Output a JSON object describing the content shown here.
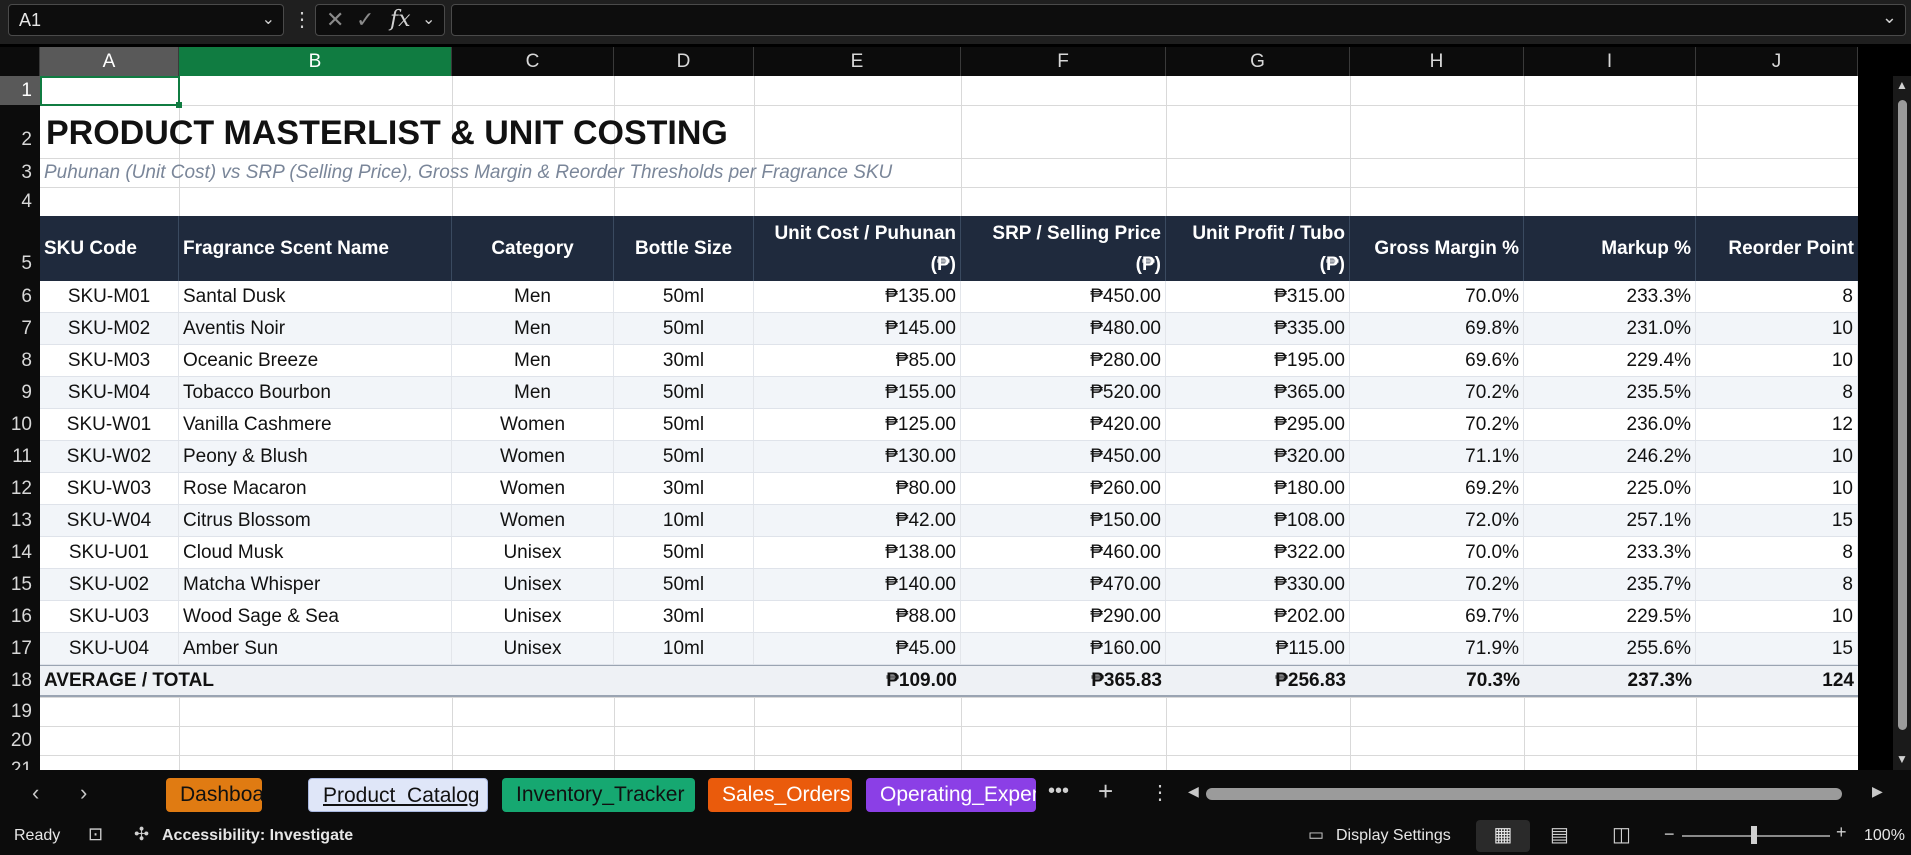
{
  "name_box": "A1",
  "formula": "",
  "columns": [
    "A",
    "B",
    "C",
    "D",
    "E",
    "F",
    "G",
    "H",
    "I",
    "J"
  ],
  "rows": [
    "1",
    "2",
    "3",
    "4",
    "5",
    "6",
    "7",
    "8",
    "9",
    "10",
    "11",
    "12",
    "13",
    "14",
    "15",
    "16",
    "17",
    "18",
    "19",
    "20",
    "21"
  ],
  "title": "PRODUCT MASTERLIST & UNIT COSTING",
  "subtitle": "Puhunan (Unit Cost) vs SRP (Selling Price), Gross Margin & Reorder Thresholds per Fragrance SKU",
  "headers": {
    "sku": "SKU Code",
    "name": "Fragrance Scent Name",
    "category": "Category",
    "size": "Bottle Size",
    "cost_l1": "Unit Cost / Puhunan",
    "cost_l2": "(₱)",
    "srp_l1": "SRP / Selling Price",
    "srp_l2": "(₱)",
    "profit_l1": "Unit Profit / Tubo",
    "profit_l2": "(₱)",
    "margin": "Gross Margin %",
    "markup": "Markup %",
    "reorder": "Reorder Point"
  },
  "products": [
    {
      "sku": "SKU-M01",
      "name": "Santal Dusk",
      "category": "Men",
      "size": "50ml",
      "cost": "₱135.00",
      "srp": "₱450.00",
      "profit": "₱315.00",
      "margin": "70.0%",
      "markup": "233.3%",
      "reorder": "8"
    },
    {
      "sku": "SKU-M02",
      "name": "Aventis Noir",
      "category": "Men",
      "size": "50ml",
      "cost": "₱145.00",
      "srp": "₱480.00",
      "profit": "₱335.00",
      "margin": "69.8%",
      "markup": "231.0%",
      "reorder": "10"
    },
    {
      "sku": "SKU-M03",
      "name": "Oceanic Breeze",
      "category": "Men",
      "size": "30ml",
      "cost": "₱85.00",
      "srp": "₱280.00",
      "profit": "₱195.00",
      "margin": "69.6%",
      "markup": "229.4%",
      "reorder": "10"
    },
    {
      "sku": "SKU-M04",
      "name": "Tobacco Bourbon",
      "category": "Men",
      "size": "50ml",
      "cost": "₱155.00",
      "srp": "₱520.00",
      "profit": "₱365.00",
      "margin": "70.2%",
      "markup": "235.5%",
      "reorder": "8"
    },
    {
      "sku": "SKU-W01",
      "name": "Vanilla Cashmere",
      "category": "Women",
      "size": "50ml",
      "cost": "₱125.00",
      "srp": "₱420.00",
      "profit": "₱295.00",
      "margin": "70.2%",
      "markup": "236.0%",
      "reorder": "12"
    },
    {
      "sku": "SKU-W02",
      "name": "Peony & Blush",
      "category": "Women",
      "size": "50ml",
      "cost": "₱130.00",
      "srp": "₱450.00",
      "profit": "₱320.00",
      "margin": "71.1%",
      "markup": "246.2%",
      "reorder": "10"
    },
    {
      "sku": "SKU-W03",
      "name": "Rose Macaron",
      "category": "Women",
      "size": "30ml",
      "cost": "₱80.00",
      "srp": "₱260.00",
      "profit": "₱180.00",
      "margin": "69.2%",
      "markup": "225.0%",
      "reorder": "10"
    },
    {
      "sku": "SKU-W04",
      "name": "Citrus Blossom",
      "category": "Women",
      "size": "10ml",
      "cost": "₱42.00",
      "srp": "₱150.00",
      "profit": "₱108.00",
      "margin": "72.0%",
      "markup": "257.1%",
      "reorder": "15"
    },
    {
      "sku": "SKU-U01",
      "name": "Cloud Musk",
      "category": "Unisex",
      "size": "50ml",
      "cost": "₱138.00",
      "srp": "₱460.00",
      "profit": "₱322.00",
      "margin": "70.0%",
      "markup": "233.3%",
      "reorder": "8"
    },
    {
      "sku": "SKU-U02",
      "name": "Matcha Whisper",
      "category": "Unisex",
      "size": "50ml",
      "cost": "₱140.00",
      "srp": "₱470.00",
      "profit": "₱330.00",
      "margin": "70.2%",
      "markup": "235.7%",
      "reorder": "8"
    },
    {
      "sku": "SKU-U03",
      "name": "Wood Sage & Sea",
      "category": "Unisex",
      "size": "30ml",
      "cost": "₱88.00",
      "srp": "₱290.00",
      "profit": "₱202.00",
      "margin": "69.7%",
      "markup": "229.5%",
      "reorder": "10"
    },
    {
      "sku": "SKU-U04",
      "name": "Amber Sun",
      "category": "Unisex",
      "size": "10ml",
      "cost": "₱45.00",
      "srp": "₱160.00",
      "profit": "₱115.00",
      "margin": "71.9%",
      "markup": "255.6%",
      "reorder": "15"
    }
  ],
  "totals": {
    "label": "AVERAGE / TOTAL",
    "cost": "₱109.00",
    "srp": "₱365.83",
    "profit": "₱256.83",
    "margin": "70.3%",
    "markup": "237.3%",
    "reorder": "124"
  },
  "tabs": [
    {
      "label": "Dashboard",
      "bg": "#e07b12",
      "fg": "#111111",
      "active": false
    },
    {
      "label": "Product_Catalog",
      "bg": "#dfe6f8",
      "fg": "#111111",
      "active": true
    },
    {
      "label": "Inventory_Tracker",
      "bg": "#16a871",
      "fg": "#111111",
      "active": false
    },
    {
      "label": "Sales_Orders",
      "bg": "#ea5b0c",
      "fg": "#ffffff",
      "active": false
    },
    {
      "label": "Operating_Expen",
      "bg": "#8b3fe6",
      "fg": "#ffffff",
      "active": false
    }
  ],
  "status": {
    "ready": "Ready",
    "accessibility": "Accessibility: Investigate",
    "display_settings": "Display Settings",
    "zoom": "100%"
  },
  "colors": {
    "header_bg": "#1f2a3d",
    "accent_green": "#107c41",
    "stripe": "#f2f5f9",
    "total_bg": "#eef1f5"
  }
}
